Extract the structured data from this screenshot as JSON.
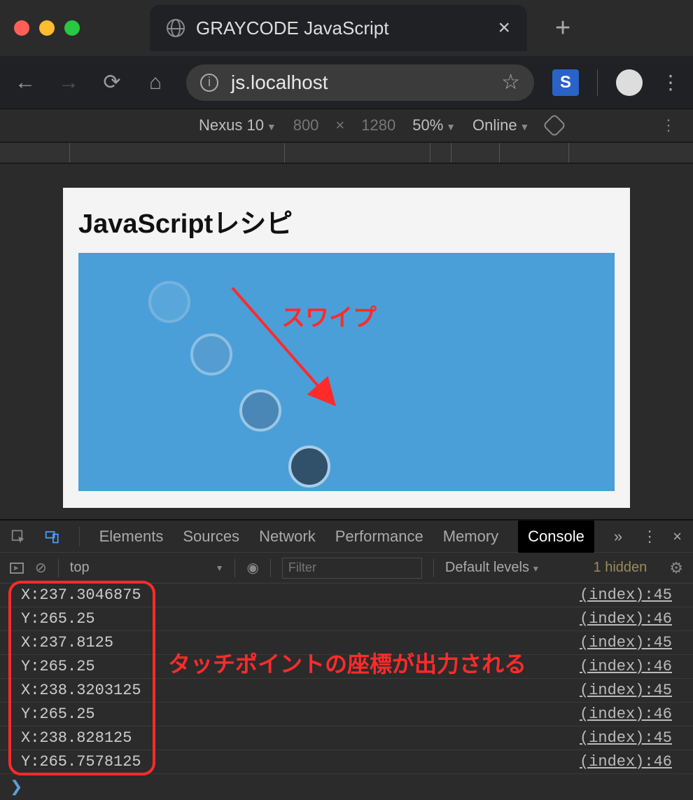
{
  "window": {
    "tab_title": "GRAYCODE JavaScript"
  },
  "urlbar": {
    "url": "js.localhost"
  },
  "device_toolbar": {
    "device": "Nexus 10",
    "width": "800",
    "height": "1280",
    "zoom": "50%",
    "throttling": "Online"
  },
  "page": {
    "heading": "JavaScriptレシピ",
    "swipe_label": "スワイプ"
  },
  "devtools": {
    "tabs": [
      "Elements",
      "Sources",
      "Network",
      "Performance",
      "Memory",
      "Console"
    ],
    "active_tab": "Console",
    "more": "»"
  },
  "console_toolbar": {
    "context": "top",
    "filter_placeholder": "Filter",
    "levels": "Default levels",
    "hidden": "1 hidden"
  },
  "console_rows": [
    {
      "msg": "X:237.3046875",
      "src": "(index):45"
    },
    {
      "msg": "Y:265.25",
      "src": "(index):46"
    },
    {
      "msg": "X:237.8125",
      "src": "(index):45"
    },
    {
      "msg": "Y:265.25",
      "src": "(index):46"
    },
    {
      "msg": "X:238.3203125",
      "src": "(index):45"
    },
    {
      "msg": "Y:265.25",
      "src": "(index):46"
    },
    {
      "msg": "X:238.828125",
      "src": "(index):45"
    },
    {
      "msg": "Y:265.7578125",
      "src": "(index):46"
    }
  ],
  "annotation": "タッチポイントの座標が出力される",
  "prompt": "❯"
}
